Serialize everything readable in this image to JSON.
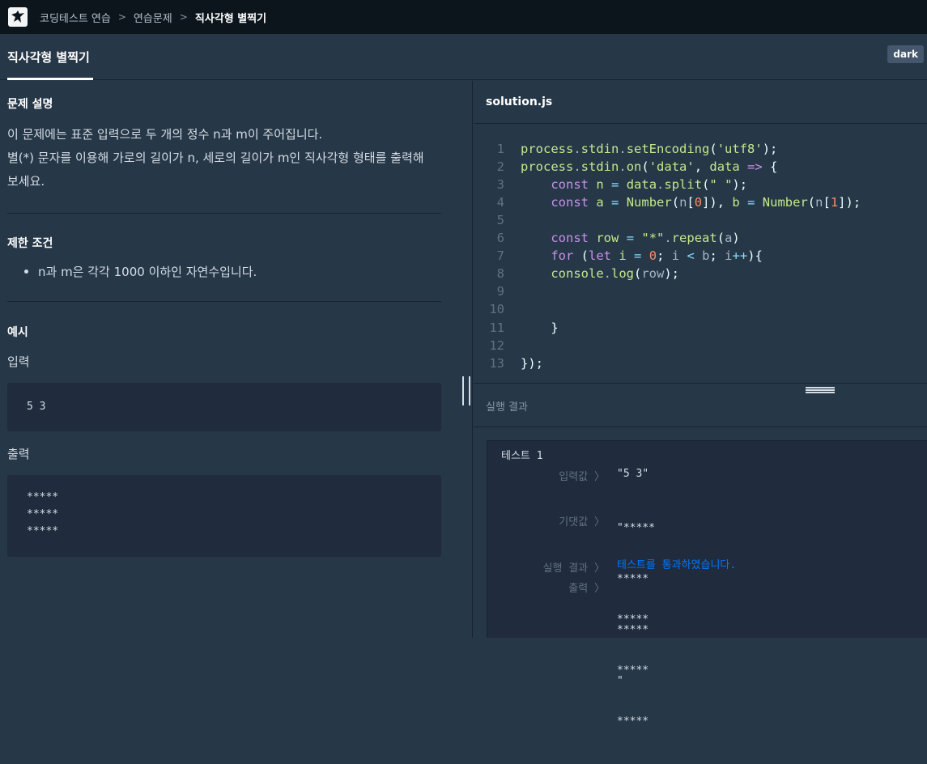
{
  "breadcrumb": {
    "items": [
      "코딩테스트 연습",
      "연습문제",
      "직사각형 별찍기"
    ]
  },
  "tab": {
    "label": "직사각형 별찍기"
  },
  "theme_button": "dark",
  "problem": {
    "description_title": "문제 설명",
    "description_lines": [
      "이 문제에는 표준 입력으로 두 개의 정수 n과 m이 주어집니다.",
      "별(*) 문자를 이용해 가로의 길이가 n, 세로의 길이가 m인 직사각형 형태를 출력해",
      "보세요."
    ],
    "constraints_title": "제한 조건",
    "constraints": [
      "n과 m은 각각 1000 이하인 자연수입니다."
    ],
    "example_title": "예시",
    "input_label": "입력",
    "input_lines": [
      "5 3"
    ],
    "output_label": "출력",
    "output_lines": [
      "*****",
      "*****",
      "*****"
    ]
  },
  "editor": {
    "file_name": "solution.js",
    "line_numbers": [
      "1",
      "2",
      "3",
      "4",
      "5",
      "6",
      "7",
      "8",
      "9",
      "10",
      "11",
      "12",
      "13"
    ]
  },
  "result": {
    "title": "실행 결과",
    "test_name": "테스트 1",
    "input_label": "입력값 〉",
    "input_value": "\"5 3\"",
    "expected_label": "기댓값 〉",
    "expected_lines": [
      "\"*****",
      "*****",
      "*****",
      "\""
    ],
    "result_label": "실행 결과 〉",
    "result_value": "테스트를 통과하였습니다.",
    "output_label": "출력 〉",
    "output_lines": [
      "*****",
      "*****",
      "*****"
    ]
  },
  "colors": {
    "background": "#263747",
    "topbar": "#0c151c",
    "pass_blue": "#0078ff"
  }
}
